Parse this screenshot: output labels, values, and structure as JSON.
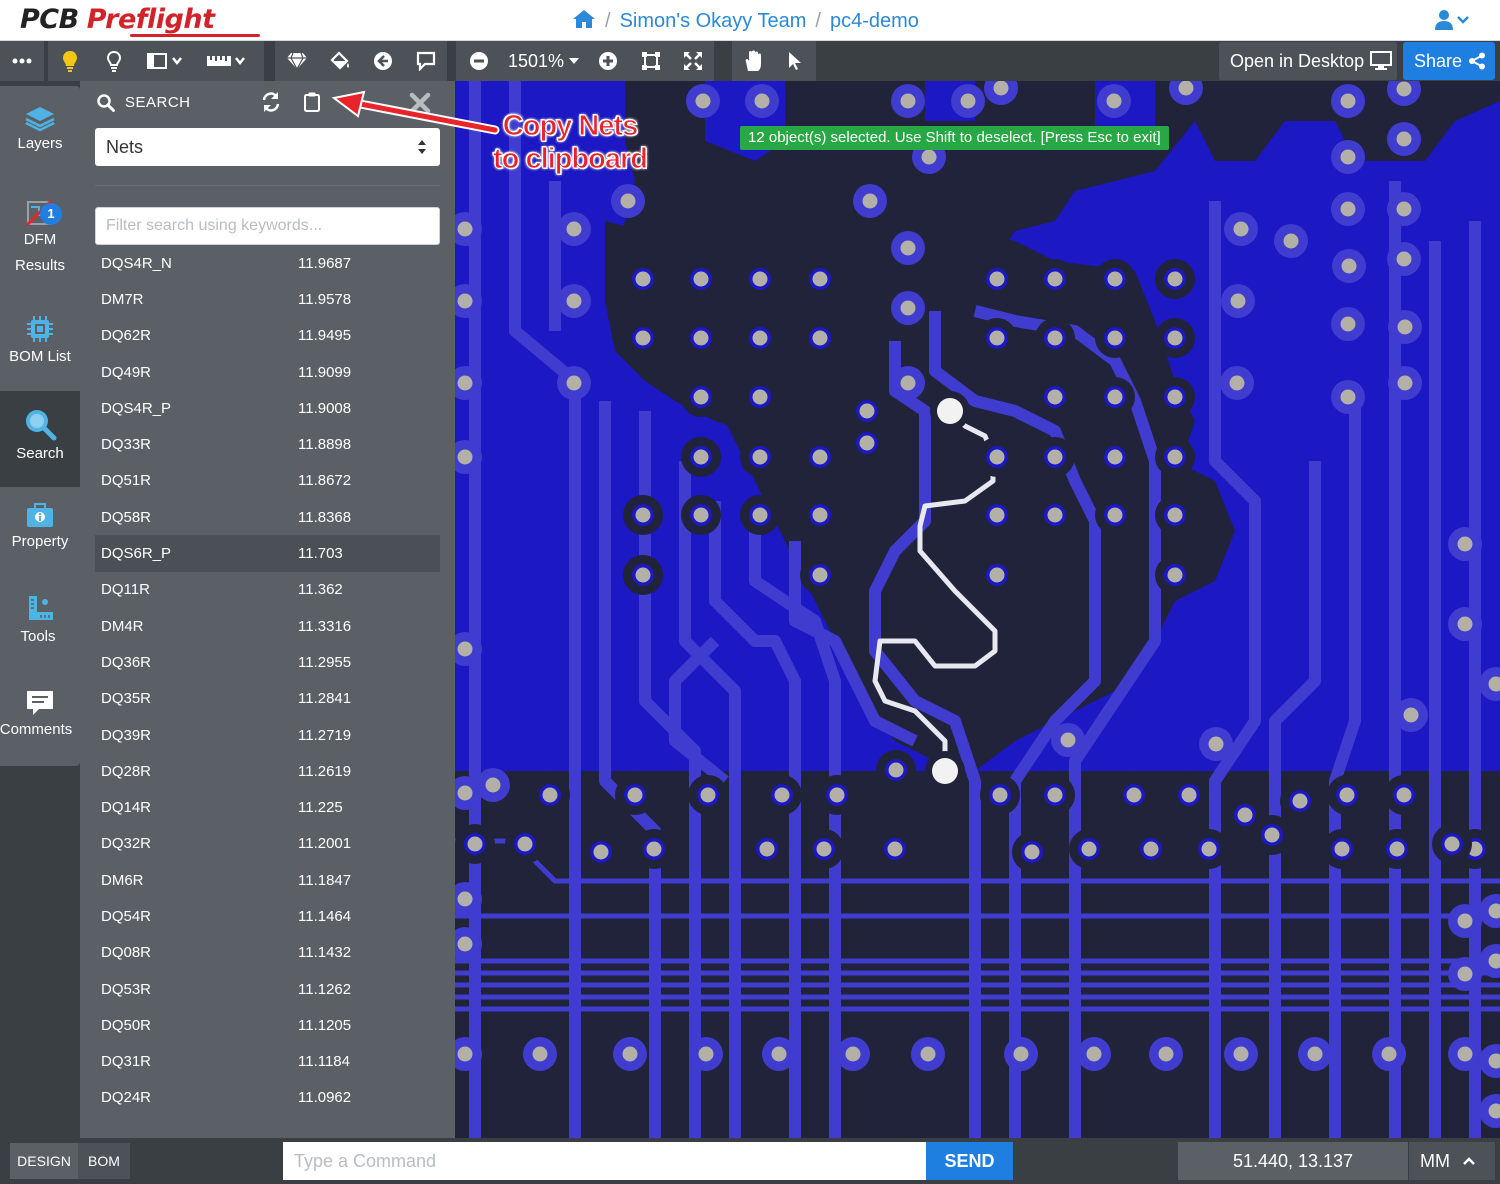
{
  "app": {
    "logo_part1": "PCB",
    "logo_part2": "Preflight"
  },
  "breadcrumb": {
    "team": "Simon's Okayy Team",
    "project": "pc4-demo"
  },
  "toolbar": {
    "zoom": "1501%",
    "open_desktop_label": "Open in Desktop",
    "share_label": "Share"
  },
  "rail": {
    "items": [
      {
        "label": "Layers"
      },
      {
        "label_line1": "DFM",
        "label_line2": "Results",
        "badge": "1"
      },
      {
        "label": "BOM List"
      },
      {
        "label": "Search"
      },
      {
        "label": "Property"
      },
      {
        "label": "Tools"
      },
      {
        "label": "Comments"
      }
    ]
  },
  "search_panel": {
    "title": "SEARCH",
    "selected_type": "Nets",
    "filter_placeholder": "Filter search using keywords...",
    "nets": [
      {
        "name": "DQS4R_N",
        "value": "11.9687"
      },
      {
        "name": "DM7R",
        "value": "11.9578"
      },
      {
        "name": "DQ62R",
        "value": "11.9495"
      },
      {
        "name": "DQ49R",
        "value": "11.9099"
      },
      {
        "name": "DQS4R_P",
        "value": "11.9008"
      },
      {
        "name": "DQ33R",
        "value": "11.8898"
      },
      {
        "name": "DQ51R",
        "value": "11.8672"
      },
      {
        "name": "DQ58R",
        "value": "11.8368"
      },
      {
        "name": "DQS6R_P",
        "value": "11.703"
      },
      {
        "name": "DQ11R",
        "value": "11.362"
      },
      {
        "name": "DM4R",
        "value": "11.3316"
      },
      {
        "name": "DQ36R",
        "value": "11.2955"
      },
      {
        "name": "DQ35R",
        "value": "11.2841"
      },
      {
        "name": "DQ39R",
        "value": "11.2719"
      },
      {
        "name": "DQ28R",
        "value": "11.2619"
      },
      {
        "name": "DQ14R",
        "value": "11.225"
      },
      {
        "name": "DQ32R",
        "value": "11.2001"
      },
      {
        "name": "DM6R",
        "value": "11.1847"
      },
      {
        "name": "DQ54R",
        "value": "11.1464"
      },
      {
        "name": "DQ08R",
        "value": "11.1432"
      },
      {
        "name": "DQ53R",
        "value": "11.1262"
      },
      {
        "name": "DQ50R",
        "value": "11.1205"
      },
      {
        "name": "DQ31R",
        "value": "11.1184"
      },
      {
        "name": "DQ24R",
        "value": "11.0962"
      }
    ]
  },
  "canvas": {
    "selection_message": "12 object(s) selected. Use Shift to deselect. [Press Esc to exit]",
    "annotation_line1": "Copy Nets",
    "annotation_line2": "to clipboard"
  },
  "bottom_bar": {
    "design_tab": "DESIGN",
    "bom_tab": "BOM",
    "command_placeholder": "Type a Command",
    "send_label": "SEND",
    "coordinates": "51.440, 13.137",
    "units": "MM"
  },
  "colors": {
    "board": "#1b18c4",
    "trace": "#3f3ccf",
    "pad_ring": "#20233a",
    "pad_center": "#b3b0a7",
    "accent": "#1f7fe0",
    "selection_banner": "#28a745",
    "annotation": "#e8232a"
  }
}
